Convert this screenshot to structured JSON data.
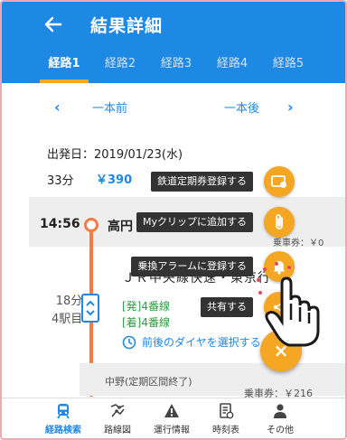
{
  "header": {
    "title": "結果詳細",
    "back_icon": "arrow-left-icon"
  },
  "tabs": [
    {
      "label": "経路1",
      "active": true
    },
    {
      "label": "経路2",
      "active": false
    },
    {
      "label": "経路3",
      "active": false
    },
    {
      "label": "経路4",
      "active": false
    },
    {
      "label": "経路5",
      "active": false
    }
  ],
  "pager": {
    "prev_label": "一本前",
    "next_label": "一本後"
  },
  "summary": {
    "date": "出発日：2019/01/23(水)",
    "duration": "33分",
    "fare": "￥390"
  },
  "route": {
    "depart_time": "14:56",
    "station": "高円",
    "ride_car_top": "乗車券：￥0",
    "train": "ＪＲ中央線快速・東京行",
    "minutes": "18分",
    "stops": "4駅目",
    "platform_depart": "[発]4番線",
    "platform_arrive": "[着]4番線",
    "select_dia": "前後のダイヤを選択する",
    "next_stop": "中野(定期区間終了)",
    "ride_car_bottom": "乗車券：￥216"
  },
  "speed_dial": [
    {
      "label": "鉄道定期券登録する",
      "icon": "commuter-pass-icon"
    },
    {
      "label": "Myクリップに追加する",
      "icon": "paperclip-icon"
    },
    {
      "label": "乗換アラームに登録する",
      "icon": "bell-icon"
    },
    {
      "label": "共有する",
      "icon": "share-icon"
    }
  ],
  "fab_label": "×",
  "bottom_nav": [
    {
      "label": "経路検索",
      "icon": "train-icon",
      "active": true
    },
    {
      "label": "路線図",
      "icon": "route-map-icon",
      "active": false
    },
    {
      "label": "運行情報",
      "icon": "warning-icon",
      "active": false
    },
    {
      "label": "時刻表",
      "icon": "timetable-icon",
      "active": false
    },
    {
      "label": "その他",
      "icon": "person-icon",
      "active": false
    }
  ],
  "colors": {
    "primary": "#1e88e5",
    "accent": "#f5a623",
    "line": "#f47b45",
    "platform": "#2e9e42"
  }
}
